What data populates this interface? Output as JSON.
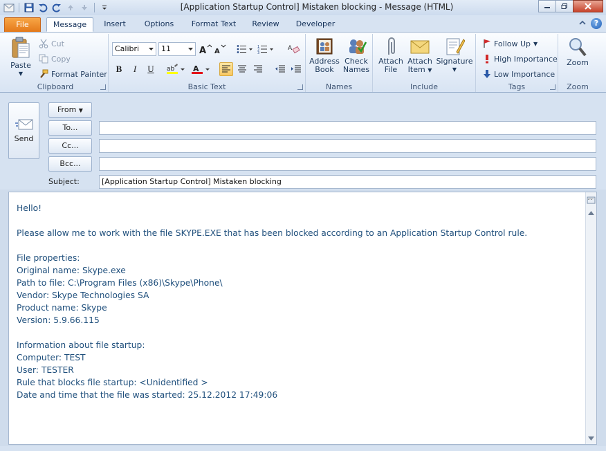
{
  "window": {
    "title": "[Application Startup Control] Mistaken blocking  -  Message (HTML)"
  },
  "tabs": [
    {
      "label": "File",
      "active": false
    },
    {
      "label": "Message",
      "active": true
    },
    {
      "label": "Insert",
      "active": false
    },
    {
      "label": "Options",
      "active": false
    },
    {
      "label": "Format Text",
      "active": false
    },
    {
      "label": "Review",
      "active": false
    },
    {
      "label": "Developer",
      "active": false
    }
  ],
  "ribbon": {
    "clipboard": {
      "label": "Clipboard",
      "paste": "Paste",
      "cut": "Cut",
      "copy": "Copy",
      "format_painter": "Format Painter"
    },
    "basic_text": {
      "label": "Basic Text",
      "font": "Calibri",
      "size": "11",
      "bold": "B",
      "italic": "I",
      "underline": "U"
    },
    "names": {
      "label": "Names",
      "address_book_1": "Address",
      "address_book_2": "Book",
      "check_names_1": "Check",
      "check_names_2": "Names"
    },
    "include": {
      "label": "Include",
      "attach_file_1": "Attach",
      "attach_file_2": "File",
      "attach_item_1": "Attach",
      "attach_item_2": "Item",
      "signature": "Signature"
    },
    "tags": {
      "label": "Tags",
      "follow_up": "Follow Up",
      "high": "High Importance",
      "low": "Low Importance"
    },
    "zoom": {
      "label": "Zoom",
      "zoom": "Zoom"
    }
  },
  "compose": {
    "send": "Send",
    "from": "From",
    "to": "To...",
    "cc": "Cc...",
    "bcc": "Bcc...",
    "subject_label": "Subject:",
    "subject_value": "[Application Startup Control] Mistaken blocking",
    "to_value": "",
    "cc_value": "",
    "bcc_value": ""
  },
  "body": {
    "text": "Hello!\n\nPlease allow me to work with the file SKYPE.EXE that has been blocked according to an Application Startup Control rule.\n\nFile properties:\nOriginal name: Skype.exe\nPath to file: C:\\Program Files (x86)\\Skype\\Phone\\\nVendor: Skype Technologies SA\nProduct name: Skype\nVersion: 5.9.66.115\n\nInformation about file startup:\nComputer: TEST\nUser: TESTER\nRule that blocks file startup: <Unidentified >\nDate and time that the file was started: 25.12.2012 17:49:06"
  },
  "colors": {
    "file_tab": "#e4791a",
    "body_text": "#1f4f7c",
    "ribbon_bg": "#e2ebf7"
  }
}
